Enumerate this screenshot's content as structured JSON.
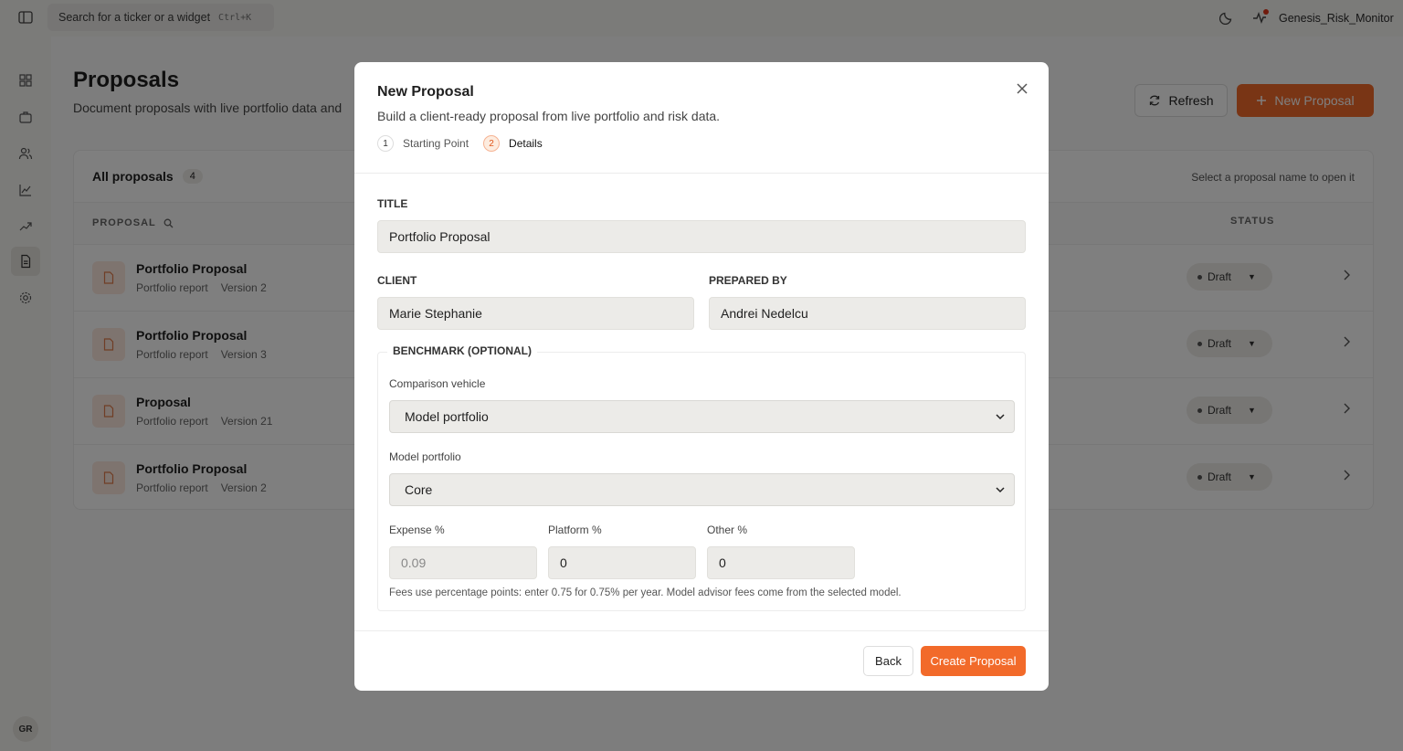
{
  "topbar": {
    "search_placeholder": "Search for a ticker or a widget",
    "search_shortcut": "Ctrl+K",
    "username": "Genesis_Risk_Monitor"
  },
  "sidebar": {
    "items": [
      {
        "icon": "dashboard-grid-icon"
      },
      {
        "icon": "briefcase-icon"
      },
      {
        "icon": "users-icon"
      },
      {
        "icon": "line-chart-icon"
      },
      {
        "icon": "trending-up-icon"
      },
      {
        "icon": "document-icon",
        "active": true
      },
      {
        "icon": "gear-icon"
      }
    ],
    "avatar_initials": "GR"
  },
  "page": {
    "title": "Proposals",
    "subtitle": "Document proposals with live portfolio data and",
    "refresh_label": "Refresh",
    "new_proposal_label": "New Proposal"
  },
  "proposals_card": {
    "heading": "All proposals",
    "count": "4",
    "hint": "Select a proposal name to open it",
    "column_proposal": "PROPOSAL",
    "column_status": "STATUS",
    "rows": [
      {
        "title": "Portfolio Proposal",
        "type": "Portfolio report",
        "version": "Version 2",
        "status": "Draft"
      },
      {
        "title": "Portfolio Proposal",
        "type": "Portfolio report",
        "version": "Version 3",
        "status": "Draft"
      },
      {
        "title": "Proposal",
        "type": "Portfolio report",
        "version": "Version 21",
        "status": "Draft"
      },
      {
        "title": "Portfolio Proposal",
        "type": "Portfolio report",
        "version": "Version 2",
        "status": "Draft"
      }
    ]
  },
  "modal": {
    "title": "New Proposal",
    "subtitle": "Build a client-ready proposal from live portfolio and risk data.",
    "steps": [
      {
        "num": "1",
        "label": "Starting Point"
      },
      {
        "num": "2",
        "label": "Details",
        "active": true
      }
    ],
    "title_label": "TITLE",
    "title_value": "Portfolio Proposal",
    "client_label": "CLIENT",
    "client_value": "Marie Stephanie",
    "prepared_by_label": "PREPARED BY",
    "prepared_by_value": "Andrei Nedelcu",
    "benchmark": {
      "legend": "BENCHMARK (OPTIONAL)",
      "comparison_label": "Comparison vehicle",
      "comparison_value": "Model portfolio",
      "model_label": "Model portfolio",
      "model_value": "Core",
      "expense_label": "Expense %",
      "expense_value": "0.09",
      "platform_label": "Platform %",
      "platform_value": "0",
      "other_label": "Other %",
      "other_value": "0",
      "hint": "Fees use percentage points: enter 0.75 for 0.75% per year. Model advisor fees come from the selected model."
    },
    "back_label": "Back",
    "create_label": "Create Proposal"
  },
  "colors": {
    "accent": "#f26a2a",
    "overlay": "rgba(0,0,0,0.5)"
  }
}
